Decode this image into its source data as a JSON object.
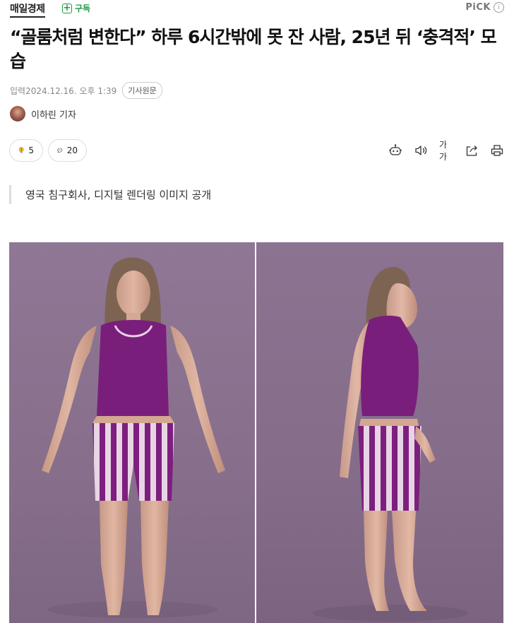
{
  "header": {
    "press_name": "매일경제",
    "subscribe_label": "구독",
    "pick_label": "PiCK",
    "info_glyph": "i"
  },
  "article": {
    "headline": "“골룸처럼 변한다” 하루 6시간밖에 못 잔 사람, 25년 뒤 ‘충격적’ 모습",
    "published_label": "입력",
    "published_date": "2024.12.16. 오후 1:39",
    "original_link_label": "기사원문",
    "reporter": "이하린 기자",
    "subheading": "영국 침구회사, 디지털 렌더링 이미지 공개"
  },
  "reactions": {
    "like_count": "5",
    "comment_count": "20"
  },
  "toolbar": {
    "font_size_label": "가가"
  },
  "colors": {
    "accent_green": "#1e9a46",
    "tank_top_purple": "#7a1e7c",
    "background_purple": "#8a7290"
  }
}
